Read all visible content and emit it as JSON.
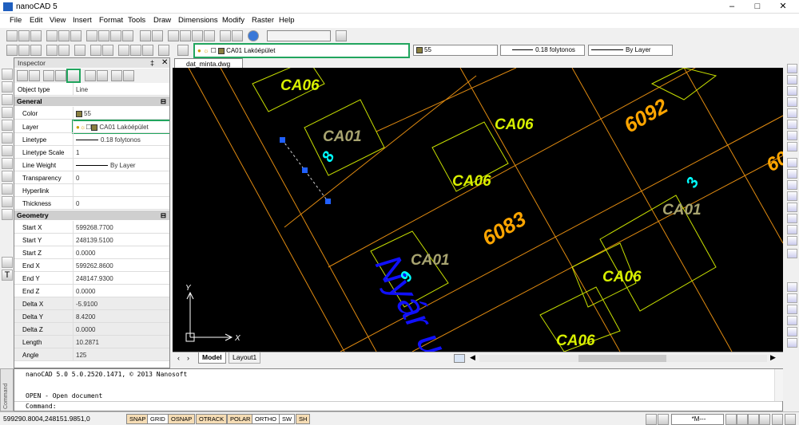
{
  "app": {
    "title": "nanoCAD 5"
  },
  "menu": [
    "File",
    "Edit",
    "View",
    "Insert",
    "Format",
    "Tools",
    "Draw",
    "Dimensions",
    "Modify",
    "Raster",
    "Help"
  ],
  "toolbar": {
    "layer_combo": "CA01 Lakóépület",
    "color_combo": "55",
    "linetype_combo": "0.18 folytonos",
    "lineweight_combo": "By Layer"
  },
  "inspector": {
    "title": "Inspector",
    "object_type_label": "Object type",
    "object_type_value": "Line",
    "general_section": "General",
    "geometry_section": "Geometry",
    "general": [
      {
        "key": "Color",
        "value": "55"
      },
      {
        "key": "Layer",
        "value": "CA01 Lakóépület"
      },
      {
        "key": "Linetype",
        "value": "0.18 folytonos"
      },
      {
        "key": "Linetype Scale",
        "value": "1"
      },
      {
        "key": "Line Weight",
        "value": "By Layer"
      },
      {
        "key": "Transparency",
        "value": "0"
      },
      {
        "key": "Hyperlink",
        "value": ""
      },
      {
        "key": "Thickness",
        "value": "0"
      }
    ],
    "geometry": [
      {
        "key": "Start X",
        "value": "599268.7700"
      },
      {
        "key": "Start Y",
        "value": "248139.5100"
      },
      {
        "key": "Start Z",
        "value": "0.0000"
      },
      {
        "key": "End X",
        "value": "599262.8600"
      },
      {
        "key": "End Y",
        "value": "248147.9300"
      },
      {
        "key": "End Z",
        "value": "0.0000"
      },
      {
        "key": "Delta X",
        "value": "-5.9100"
      },
      {
        "key": "Delta Y",
        "value": "8.4200"
      },
      {
        "key": "Delta Z",
        "value": "0.0000"
      },
      {
        "key": "Length",
        "value": "10.2871"
      },
      {
        "key": "Angle",
        "value": "125"
      }
    ]
  },
  "document_tab": "dat_minta.dwg",
  "layout_tabs": [
    "Model",
    "Layout1"
  ],
  "drawing": {
    "street_name": "Nyár utca",
    "labels": [
      "CA06",
      "CA01",
      "8",
      "CA06",
      "6092",
      "CA06",
      "6083",
      "CA01",
      "9",
      "CA06",
      "3",
      "CA01",
      "60",
      "CA06"
    ],
    "ucs_x": "X",
    "ucs_y": "Y"
  },
  "command": {
    "side_label": "Command",
    "lines": [
      "nanoCAD 5.0 5.0.2520.1471, © 2013 Nanosoft",
      "",
      "OPEN - Open document"
    ],
    "prompt": "Command:"
  },
  "status": {
    "coords": "599290.8004,248151.9851,0",
    "buttons": [
      "SNAP",
      "GRID",
      "OSNAP",
      "OTRACK",
      "POLAR",
      "ORTHO",
      "SW",
      "SH"
    ],
    "scale": "*M---"
  },
  "colors": {
    "highlight": "#21a55e",
    "yellow_green": "#d8f000",
    "olive": "#a8a470",
    "orange": "#ffa500",
    "cyan": "#00ffff",
    "blue": "#1010ff"
  }
}
